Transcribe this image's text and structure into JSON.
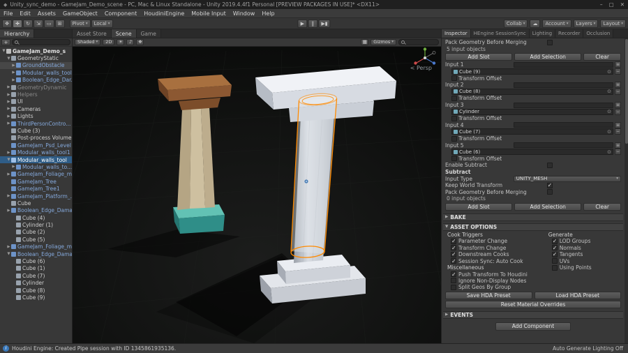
{
  "window": {
    "title": "Unity_sync_demo - GameJam_Demo_scene - PC, Mac & Linux Standalone - Unity 2019.4.4f1 Personal [PREVIEW PACKAGES IN USE]* <DX11>"
  },
  "icons": {
    "logo": "◆",
    "minimize": "–",
    "maximize": "▢",
    "close": "✕",
    "dropdown": "▾",
    "fold_open": "▼",
    "fold_closed": "▶",
    "menu": "≡",
    "minus": "−",
    "picker": "⊙",
    "cloud": "☁",
    "sun": "☀",
    "audio": "♪",
    "fx": "❖",
    "grid": "▦",
    "info": "i",
    "plus": "+"
  },
  "menu": {
    "items": [
      "File",
      "Edit",
      "Assets",
      "GameObject",
      "Component",
      "HoudiniEngine",
      "Mobile Input",
      "Window",
      "Help"
    ]
  },
  "toolbar": {
    "tools": [
      {
        "name": "hand-tool",
        "glyph": "✥"
      },
      {
        "name": "move-tool",
        "glyph": "✛"
      },
      {
        "name": "rotate-tool",
        "glyph": "↻"
      },
      {
        "name": "scale-tool",
        "glyph": "⇲"
      },
      {
        "name": "rect-tool",
        "glyph": "▭"
      },
      {
        "name": "transform-tool",
        "glyph": "⊞"
      }
    ],
    "pivot": "Pivot",
    "local": "Local",
    "play": "▶",
    "pause": "‖",
    "step": "▶▮",
    "collab": "Collab",
    "account": "Account",
    "layers": "Layers",
    "layout": "Layout"
  },
  "hierarchy": {
    "tab": "Hierarchy",
    "items": [
      {
        "label": "GameJam_Demo_s",
        "pad": 2,
        "cls": "scene",
        "arrow": "▼"
      },
      {
        "label": "GeometryStatic",
        "pad": 9,
        "cls": "",
        "arrow": "▼"
      },
      {
        "label": "GroundObstacle",
        "pad": 16,
        "cls": "blue hl",
        "arrow": "▶"
      },
      {
        "label": "Modular_walls_tool",
        "pad": 16,
        "cls": "blue",
        "arrow": "▶"
      },
      {
        "label": "Boolean_Edge_Dar...",
        "pad": 16,
        "cls": "blue",
        "arrow": "▶"
      },
      {
        "label": "GeometryDynamic",
        "pad": 9,
        "cls": "dim",
        "arrow": "▶"
      },
      {
        "label": "Helpers",
        "pad": 9,
        "cls": "dim",
        "arrow": "▶"
      },
      {
        "label": "UI",
        "pad": 9,
        "cls": "",
        "arrow": "▶"
      },
      {
        "label": "Cameras",
        "pad": 9,
        "cls": "",
        "arrow": "▶"
      },
      {
        "label": "Lights",
        "pad": 9,
        "cls": "",
        "arrow": "▶"
      },
      {
        "label": "ThirdPersonContro...",
        "pad": 9,
        "cls": "blue",
        "arrow": "▶"
      },
      {
        "label": "Cube (3)",
        "pad": 9,
        "cls": "",
        "arrow": ""
      },
      {
        "label": "Post-process Volume",
        "pad": 9,
        "cls": "",
        "arrow": ""
      },
      {
        "label": "GameJam_Psd_Level",
        "pad": 9,
        "cls": "blue",
        "arrow": ""
      },
      {
        "label": "Modular_walls_tool1",
        "pad": 9,
        "cls": "blue",
        "arrow": "▶"
      },
      {
        "label": "Modular_walls_tool",
        "pad": 9,
        "cls": "sel",
        "arrow": "▼"
      },
      {
        "label": "Modular_walls_to...",
        "pad": 16,
        "cls": "blue",
        "arrow": "▶"
      },
      {
        "label": "GameJam_Foliage_m...",
        "pad": 9,
        "cls": "blue",
        "arrow": "▶"
      },
      {
        "label": "GameJam_Tree",
        "pad": 9,
        "cls": "blue",
        "arrow": ""
      },
      {
        "label": "GameJam_Tree1",
        "pad": 9,
        "cls": "blue",
        "arrow": ""
      },
      {
        "label": "GameJam_Platform_...",
        "pad": 9,
        "cls": "blue",
        "arrow": "▶"
      },
      {
        "label": "Cube",
        "pad": 9,
        "cls": "",
        "arrow": ""
      },
      {
        "label": "Boolean_Edge_Dama...",
        "pad": 9,
        "cls": "blue",
        "arrow": "▶"
      },
      {
        "label": "Cube (4)",
        "pad": 16,
        "cls": "",
        "arrow": ""
      },
      {
        "label": "Cylinder (1)",
        "pad": 16,
        "cls": "",
        "arrow": ""
      },
      {
        "label": "Cube (2)",
        "pad": 16,
        "cls": "",
        "arrow": ""
      },
      {
        "label": "Cube (5)",
        "pad": 16,
        "cls": "",
        "arrow": ""
      },
      {
        "label": "GameJam_Foliage_m...",
        "pad": 9,
        "cls": "blue",
        "arrow": "▶"
      },
      {
        "label": "Boolean_Edge_Dama...",
        "pad": 9,
        "cls": "blue",
        "arrow": "▼"
      },
      {
        "label": "Cube (6)",
        "pad": 16,
        "cls": "",
        "arrow": ""
      },
      {
        "label": "Cube (1)",
        "pad": 16,
        "cls": "",
        "arrow": ""
      },
      {
        "label": "Cube (7)",
        "pad": 16,
        "cls": "",
        "arrow": ""
      },
      {
        "label": "Cylinder",
        "pad": 16,
        "cls": "",
        "arrow": ""
      },
      {
        "label": "Cube (8)",
        "pad": 16,
        "cls": "",
        "arrow": ""
      },
      {
        "label": "Cube (9)",
        "pad": 16,
        "cls": "",
        "arrow": ""
      }
    ]
  },
  "scene": {
    "tabs": [
      {
        "label": "Asset Store",
        "cls": ""
      },
      {
        "label": "Scene",
        "cls": "active"
      },
      {
        "label": "Game",
        "cls": ""
      }
    ],
    "toolbar": {
      "shaded": "Shaded",
      "two_d": "2D",
      "gizmos": "Gizmos"
    },
    "persp_label": "< Persp"
  },
  "inspector": {
    "tabs": [
      {
        "label": "Inspector",
        "cls": "active"
      },
      {
        "label": "HEngine SessionSync",
        "cls": ""
      },
      {
        "label": "Lighting",
        "cls": ""
      },
      {
        "label": "Recorder",
        "cls": ""
      },
      {
        "label": "Occlusion",
        "cls": ""
      }
    ],
    "top": {
      "pack_label": "Pack Geometry Before Merging",
      "count_label": "5 input objects",
      "add_slot": "Add Slot",
      "add_selection": "Add Selection",
      "clear": "Clear"
    },
    "inputs": [
      {
        "label": "Input 1",
        "object": "Cube (9)",
        "offset": "Transform Offset"
      },
      {
        "label": "Input 2",
        "object": "Cube (8)",
        "offset": "Transform Offset"
      },
      {
        "label": "Input 3",
        "object": "Cylinder",
        "offset": "Transform Offset"
      },
      {
        "label": "Input 4",
        "object": "Cube (7)",
        "offset": "Transform Offset"
      },
      {
        "label": "Input 5",
        "object": "Cube (6)",
        "offset": "Transform Offset"
      }
    ],
    "subtract": {
      "enable_label": "Enable Subtract",
      "header": "Subtract",
      "input_type_label": "Input Type",
      "input_type_value": "UNITY_MESH",
      "keep_world": "Keep World Transform",
      "pack_label": "Pack Geometry Before Merging",
      "count_label": "0 input objects",
      "add_slot": "Add Slot",
      "add_selection": "Add Selection",
      "clear": "Clear"
    },
    "bake_header": "BAKE",
    "asset_options": {
      "header": "ASSET OPTIONS",
      "cook_header": "Cook Triggers",
      "generate_header": "Generate",
      "cook": [
        {
          "label": "Parameter Change",
          "state": "on"
        },
        {
          "label": "Transform Change",
          "state": "on"
        },
        {
          "label": "Downstream Cooks",
          "state": "on"
        },
        {
          "label": "Session Sync: Auto Cook",
          "state": "on"
        }
      ],
      "generate": [
        {
          "label": "LOD Groups",
          "state": "on"
        },
        {
          "label": "Normals",
          "state": "on"
        },
        {
          "label": "Tangents",
          "state": "on"
        },
        {
          "label": "UVs",
          "state": "off"
        },
        {
          "label": "Using Points",
          "state": "off"
        }
      ],
      "misc_header": "Miscellaneous",
      "misc": [
        {
          "label": "Push Transform To Houdini",
          "state": "on"
        },
        {
          "label": "Ignore Non-Display Nodes",
          "state": "off"
        },
        {
          "label": "Split Geos By Group",
          "state": "off"
        }
      ],
      "save_preset": "Save HDA Preset",
      "load_preset": "Load HDA Preset",
      "reset_material": "Reset Material Overrides"
    },
    "events_header": "EVENTS",
    "add_component": "Add Component"
  },
  "status": {
    "message": "Houdini Engine: Created Pipe session with ID 1345861935136.",
    "right": "Auto Generate Lighting Off"
  }
}
